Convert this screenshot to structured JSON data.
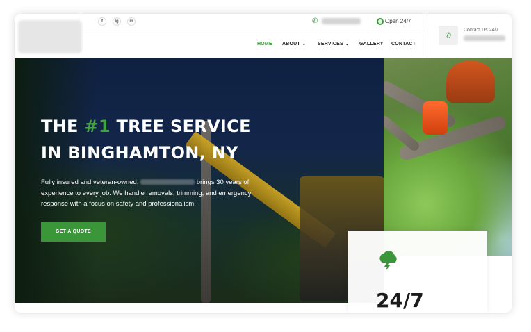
{
  "header": {
    "social": [
      "f",
      "ig",
      "in"
    ],
    "phone_icon": "phone-icon",
    "open_label": "Open 24/7",
    "nav": [
      "HOME",
      "ABOUT",
      "SERVICES",
      "GALLERY",
      "CONTACT"
    ],
    "nav_caret": "⌄",
    "contact_label": "Contact Us 24/7"
  },
  "hero": {
    "title_line1_a": "THE ",
    "title_line1_accent": "#1",
    "title_line1_b": " TREE SERVICE",
    "title_line2": "IN BINGHAMTON, NY",
    "desc_part1": "Fully insured and veteran-owned,",
    "desc_part2": "brings 30 years of experience to every job. We handle removals, trimming, and emergency response with a focus on safety and professionalism.",
    "cta_label": "GET A QUOTE"
  },
  "card": {
    "icon": "storm-cloud-icon",
    "value": "24/7"
  },
  "colors": {
    "accent": "#3a9638",
    "hero_overlay": "#13264a"
  }
}
